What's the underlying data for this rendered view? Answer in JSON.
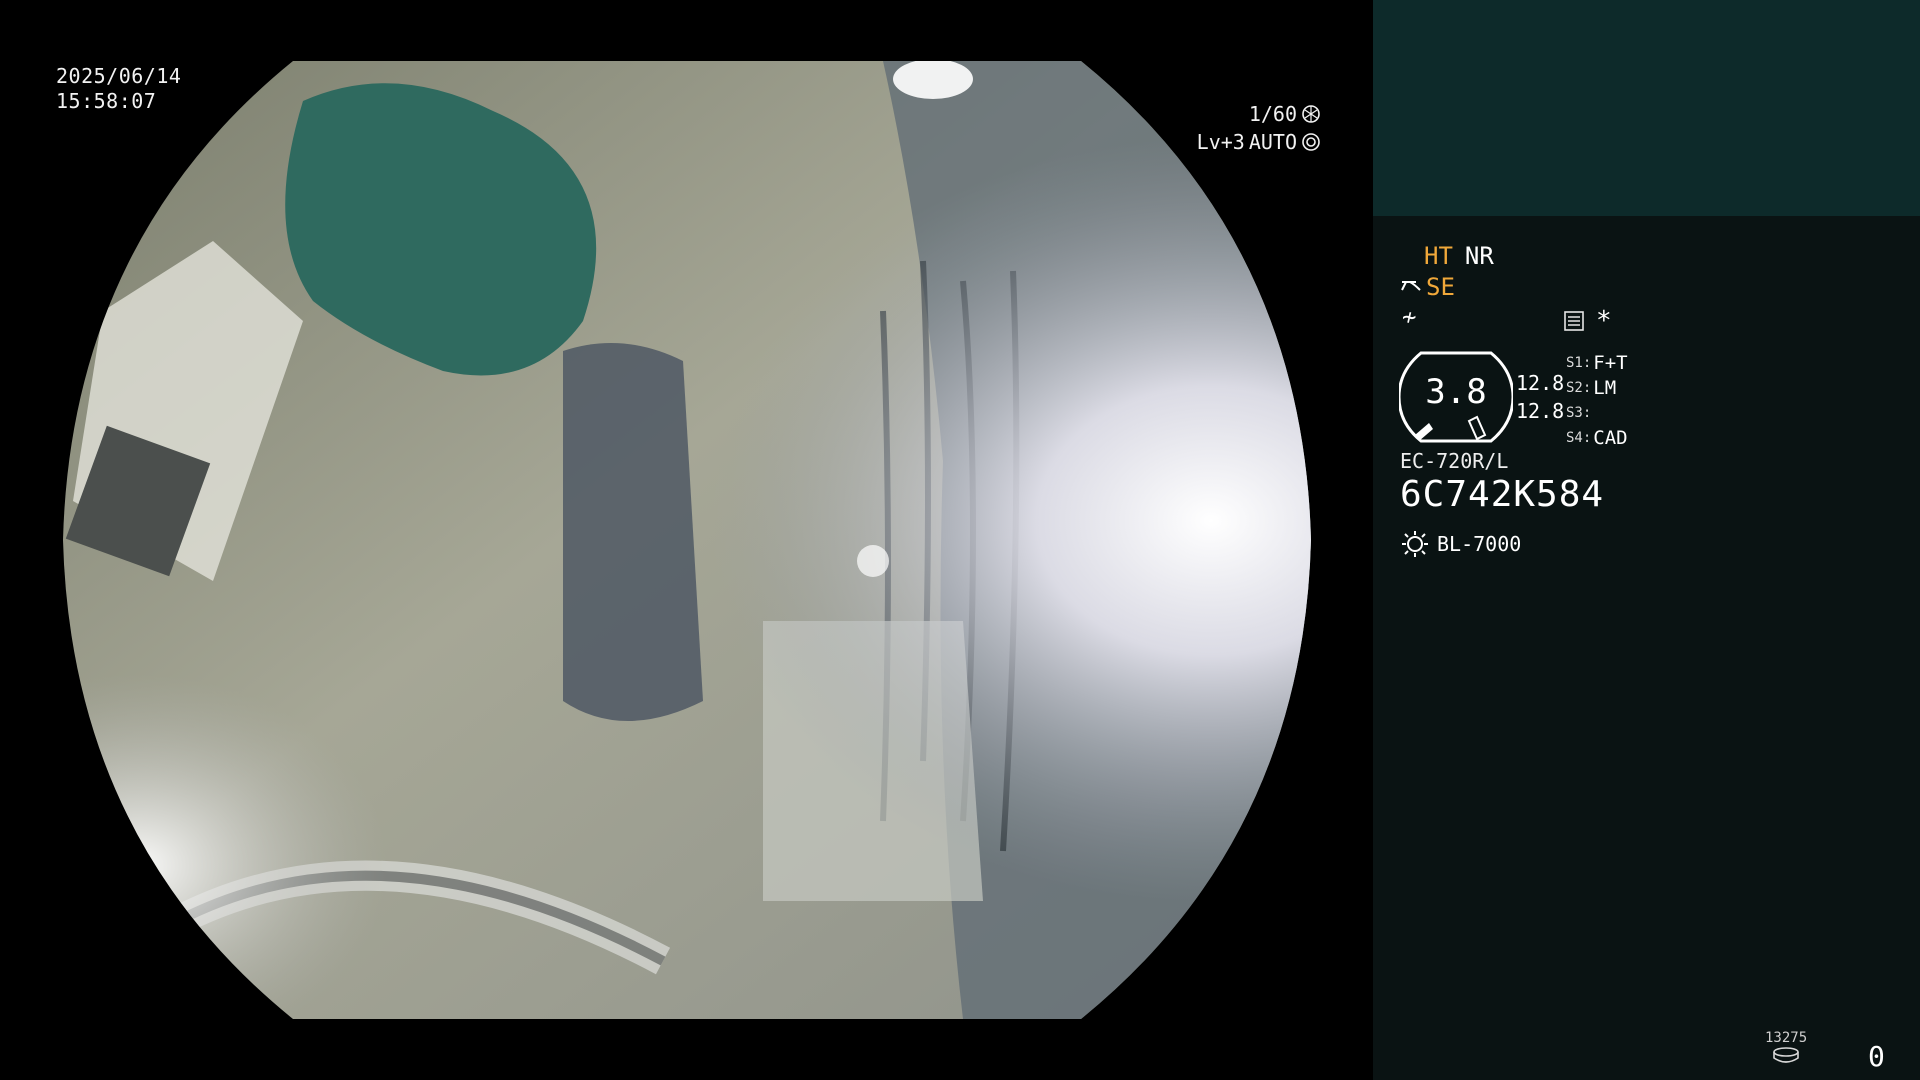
{
  "osd": {
    "date": "2025/06/14",
    "time": "15:58:07",
    "shutter": "1/60",
    "level": "Lv+3",
    "iris_mode": "AUTO",
    "shutter_icon": "aperture-icon",
    "iris_icon": "iris-icon"
  },
  "panel": {
    "ht": "HT",
    "nr": "NR",
    "se": "SE",
    "mode_symbol": "≁",
    "asterisk": "*",
    "gauge_value": "3.8",
    "readout_1": "12.8",
    "readout_2": "12.8",
    "s1_label": "S1:",
    "s1_value": "F+T",
    "s2_label": "S2:",
    "s2_value": "LM",
    "s3_label": "S3:",
    "s3_value": "",
    "s4_label": "S4:",
    "s4_value": "CAD",
    "scope_model": "EC-720R/L",
    "serial": "6C742K584",
    "light_source": "BL-7000",
    "counter": "13275",
    "count_right": "0"
  },
  "colors": {
    "accent_orange": "#f0a83a",
    "panel_bg": "#0a1313",
    "panel_top_bg": "#0d2a2a"
  }
}
